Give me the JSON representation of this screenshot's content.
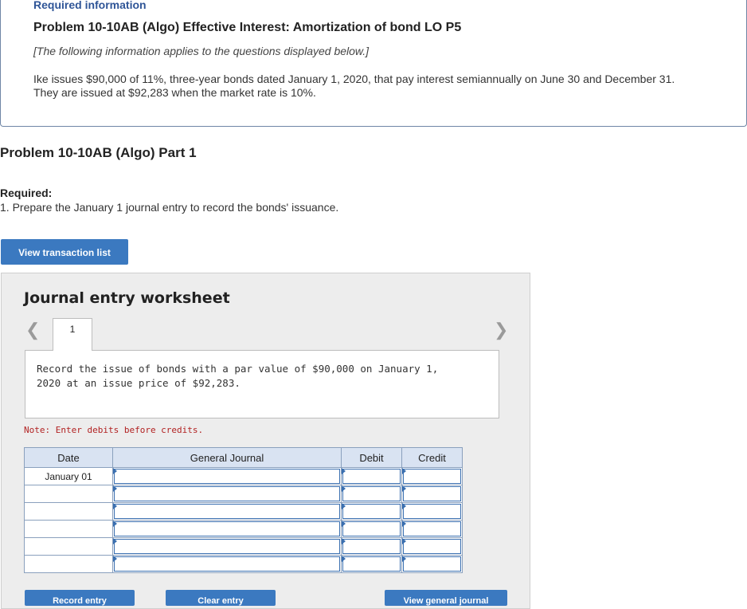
{
  "info": {
    "heading": "Required information",
    "problem_title": "Problem 10-10AB (Algo) Effective Interest: Amortization of bond LO P5",
    "note": "[The following information applies to the questions displayed below.]",
    "text": "Ike issues $90,000 of 11%, three-year bonds dated January 1, 2020, that pay interest semiannually on June 30 and December 31. They are issued at $92,283 when the market rate is 10%."
  },
  "part": {
    "title": "Problem 10-10AB (Algo) Part 1",
    "required_label": "Required:",
    "required_text": "1. Prepare the January 1 journal entry to record the bonds' issuance."
  },
  "buttons": {
    "view_transactions": "View transaction list",
    "record_entry": "Record entry",
    "clear_entry": "Clear entry",
    "view_general_journal": "View general journal"
  },
  "worksheet": {
    "title": "Journal entry worksheet",
    "tab_number": "1",
    "description": "Record the issue of bonds with a par value of $90,000 on January 1, 2020 at an issue price of $92,283.",
    "note": "Note: Enter debits before credits.",
    "columns": [
      "Date",
      "General Journal",
      "Debit",
      "Credit"
    ],
    "rows": [
      {
        "date": "January 01",
        "account": "",
        "debit": "",
        "credit": ""
      },
      {
        "date": "",
        "account": "",
        "debit": "",
        "credit": ""
      },
      {
        "date": "",
        "account": "",
        "debit": "",
        "credit": ""
      },
      {
        "date": "",
        "account": "",
        "debit": "",
        "credit": ""
      },
      {
        "date": "",
        "account": "",
        "debit": "",
        "credit": ""
      },
      {
        "date": "",
        "account": "",
        "debit": "",
        "credit": ""
      }
    ]
  },
  "colors": {
    "accent": "#3b79c0",
    "title_blue": "#2f5597",
    "note_red": "#b22222",
    "header_bg": "#d9e3f2"
  }
}
